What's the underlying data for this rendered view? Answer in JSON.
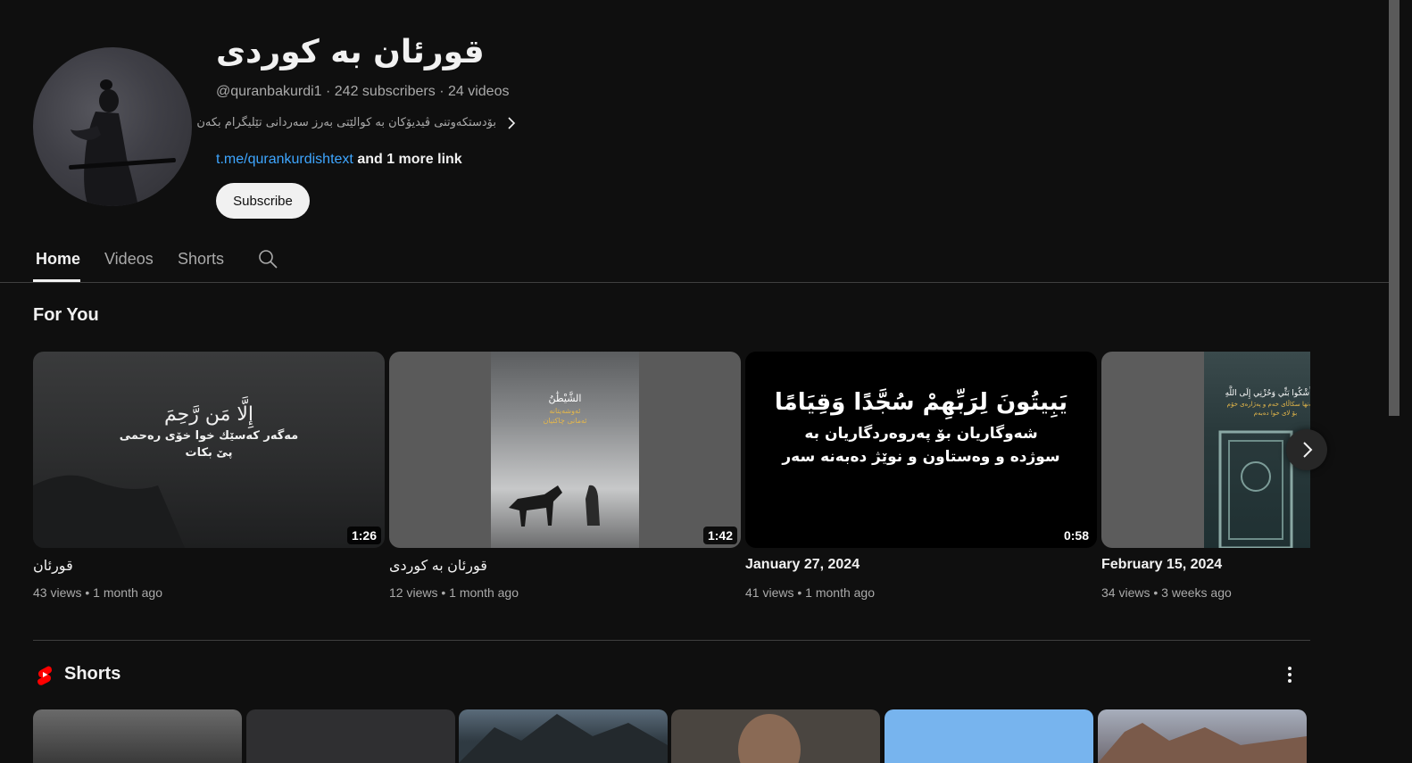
{
  "channel": {
    "title": "قورئان بە کوردی",
    "handle": "@quranbakurdi1",
    "subscribers": "242 subscribers",
    "videos": "24 videos",
    "description": "بۆدستکەوتنی ڤیدیۆکان بە کوالێتی بەرز سەردانی تێلیگرام بکەن",
    "link_text": "t.me/qurankurdishtext",
    "more_links": "and 1 more link",
    "subscribe_label": "Subscribe",
    "separator": "·"
  },
  "tabs": [
    {
      "label": "Home",
      "active": true
    },
    {
      "label": "Videos",
      "active": false
    },
    {
      "label": "Shorts",
      "active": false
    }
  ],
  "for_you": {
    "title": "For You",
    "videos": [
      {
        "title": "قورئان",
        "views": "43 views",
        "age": "1 month ago",
        "duration": "1:26",
        "thumb_lines": [
          "إِلَّا مَن رَّحِمَ",
          "مەگەر کەسێك خوا خۆی رەحمی",
          "پێ بکات"
        ]
      },
      {
        "title": "قورئان بە کوردی",
        "views": "12 views",
        "age": "1 month ago",
        "duration": "1:42",
        "thumb_lines": [
          "الشَّيْطَٰنُ",
          "ئەوشەیتانە",
          "ئەمانی چاکتیان"
        ]
      },
      {
        "title": "January 27, 2024",
        "views": "41 views",
        "age": "1 month ago",
        "duration": "0:58",
        "thumb_lines": [
          "يَبِيتُونَ لِرَبِّهِمْ سُجَّدًا وَقِيَامًا",
          "شەوگاریان بۆ پەروەردگاریان بە",
          "سوژدە و وەستاون و نوێژ دەبەنە سەر"
        ]
      },
      {
        "title": "February 15, 2024",
        "views": "34 views",
        "age": "3 weeks ago",
        "duration": "",
        "thumb_lines": [
          "إِنَّمَا أَشْكُوا بَثِّي وَحُزْنِي إِلَى اللَّهِ",
          "من تەنها سکاڵای خەم و پەژارەی خۆم",
          "بۆ لای خوا دەبەم"
        ]
      }
    ],
    "meta_separator": "•"
  },
  "shorts": {
    "title": "Shorts"
  },
  "icons": {
    "search": "search-icon",
    "chevron": "chevron-right-icon",
    "shorts": "shorts-logo-icon",
    "more": "more-vert-icon"
  },
  "colors": {
    "background": "#0f0f0f",
    "link": "#3ea6ff",
    "shorts_red": "#ff0000",
    "muted_text": "#aaaaaa"
  }
}
